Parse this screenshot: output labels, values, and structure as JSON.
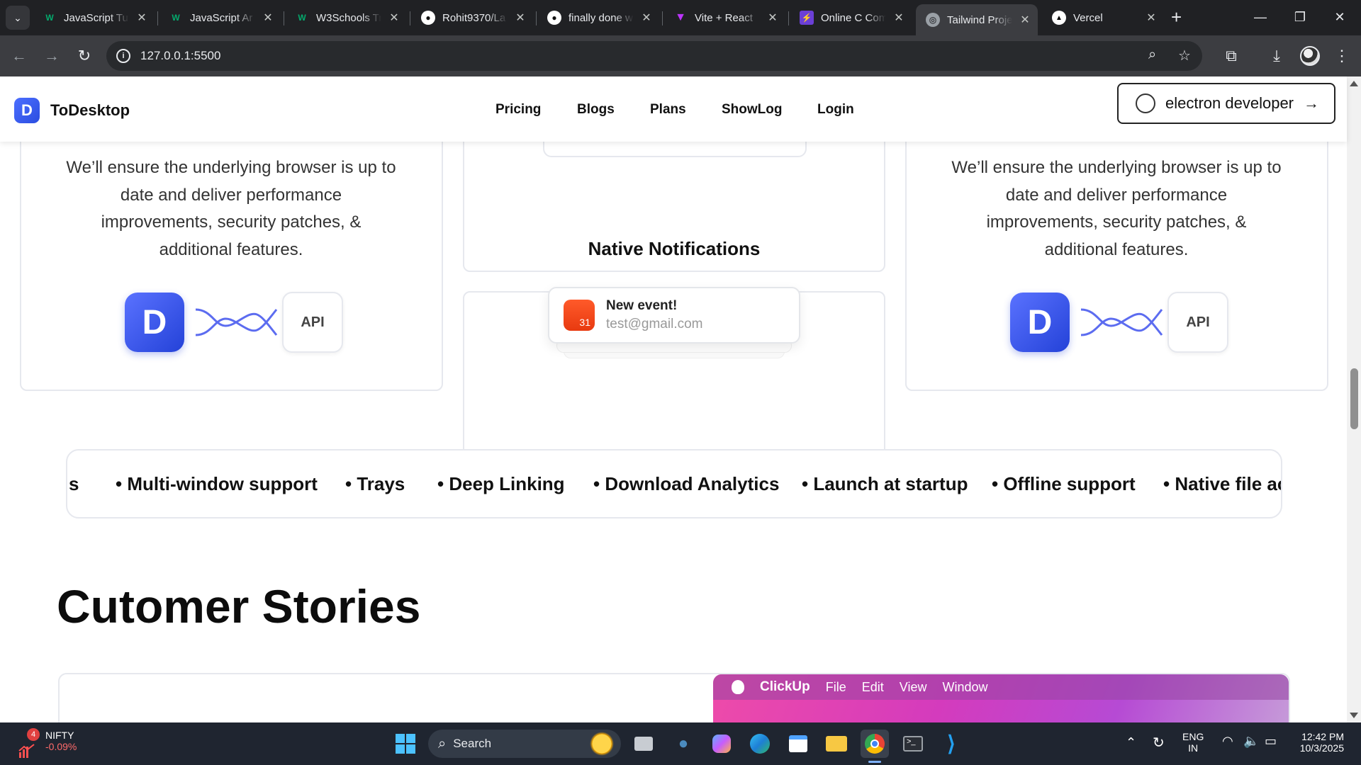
{
  "browser": {
    "tabs": [
      {
        "title": "JavaScript Tut",
        "favicon": "w3schools-icon",
        "active": false
      },
      {
        "title": "JavaScript Ar",
        "favicon": "w3schools-icon",
        "active": false
      },
      {
        "title": "W3Schools Tr",
        "favicon": "w3schools-icon",
        "active": false
      },
      {
        "title": "Rohit9370/La",
        "favicon": "github-icon",
        "active": false
      },
      {
        "title": "finally done w",
        "favicon": "github-icon",
        "active": false
      },
      {
        "title": "Vite + React",
        "favicon": "vite-icon",
        "active": false
      },
      {
        "title": "Online C Com",
        "favicon": "bolt-icon",
        "active": false
      },
      {
        "title": "Tailwind Proje",
        "favicon": "globe-icon",
        "active": true
      },
      {
        "title": "Vercel",
        "favicon": "vercel-icon",
        "active": false
      }
    ],
    "url": "127.0.0.1:5500"
  },
  "site": {
    "brand": "ToDesktop",
    "nav": [
      "Pricing",
      "Blogs",
      "Plans",
      "ShowLog",
      "Login"
    ],
    "cta_label": "electron developer",
    "feature_text": "We’ll ensure the underlying browser is up to date and deliver performance improvements, security patches, & additional features.",
    "api_label": "API",
    "notifications": {
      "title": "Native Notifications",
      "event_title": "New event!",
      "event_email": "test@gmail.com",
      "calendar_day": "31"
    },
    "marquee": [
      "s",
      "• Multi-window support",
      "• Trays",
      "• Deep Linking",
      "• Download Analytics",
      "• Launch at startup",
      "• Offline support",
      "• Native file ac"
    ],
    "stories_title": "Cutomer Stories",
    "story_menu": {
      "app": "ClickUp",
      "items": [
        "File",
        "Edit",
        "View",
        "Window"
      ]
    }
  },
  "taskbar": {
    "stock_name": "NIFTY",
    "stock_change": "-0.09%",
    "stock_badge": "4",
    "search_label": "Search",
    "lang": "ENG",
    "region": "IN",
    "time": "12:42 PM",
    "date": "10/3/2025"
  },
  "colors": {
    "accent": "#2b4de0",
    "notification": "#e83a10",
    "clickup": "#d43bbd"
  }
}
